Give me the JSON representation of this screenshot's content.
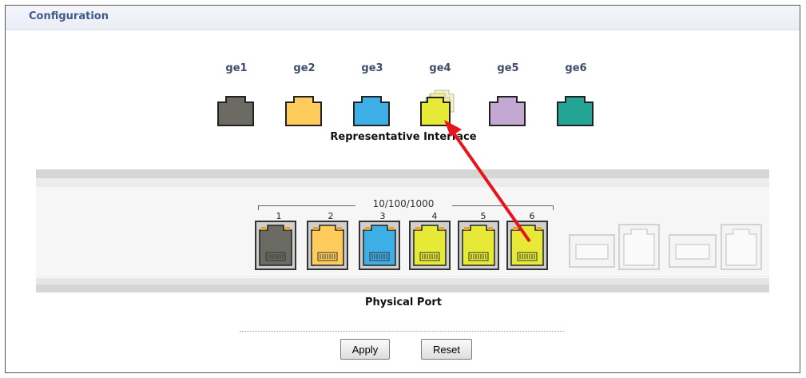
{
  "header": {
    "title": "Configuration"
  },
  "representative": {
    "label": "Representative Interface",
    "interfaces": [
      {
        "name": "ge1",
        "color": "#6b6b63"
      },
      {
        "name": "ge2",
        "color": "#ffcc5c"
      },
      {
        "name": "ge3",
        "color": "#3daee6"
      },
      {
        "name": "ge4",
        "color": "#e6ea36"
      },
      {
        "name": "ge5",
        "color": "#c3a8d4"
      },
      {
        "name": "ge6",
        "color": "#22a594"
      }
    ]
  },
  "physical": {
    "label": "Physical Port",
    "speed_label": "10/100/1000",
    "ports": [
      {
        "number": "1",
        "color": "#6b6b63"
      },
      {
        "number": "2",
        "color": "#ffcc5c"
      },
      {
        "number": "3",
        "color": "#3daee6"
      },
      {
        "number": "4",
        "color": "#e6ea36"
      },
      {
        "number": "5",
        "color": "#e6ea36"
      },
      {
        "number": "6",
        "color": "#e6ea36"
      }
    ]
  },
  "buttons": {
    "apply": "Apply",
    "reset": "Reset"
  },
  "colors": {
    "title": "#3e5b8a",
    "annotation_arrow": "#e8141c",
    "ghost_port": "#d9d9d9"
  },
  "icons": [
    "interface-icon",
    "ethernet-port-icon",
    "sfp-slot-icon",
    "annotation-arrow-icon"
  ]
}
